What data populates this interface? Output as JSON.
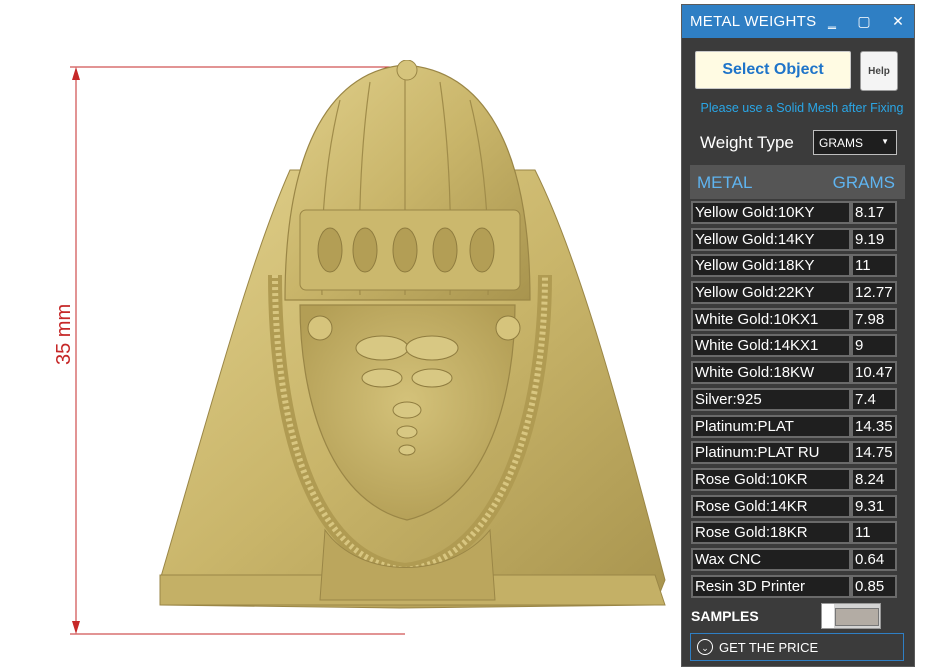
{
  "viewport": {
    "dimension_label": "35 mm",
    "colors": {
      "dimension": "#c62828",
      "model": "#c9b56a"
    }
  },
  "panel": {
    "title": "METAL WEIGHTS",
    "window_buttons": {
      "minimize": "‗",
      "maximize": "▢",
      "close": "✕"
    },
    "select_object_label": "Select Object",
    "help_label": "Help",
    "hint": "Please use a Solid Mesh after Fixing",
    "weight_type_label": "Weight Type",
    "weight_type_value": "GRAMS",
    "table_header": {
      "metal": "METAL",
      "unit": "GRAMS"
    },
    "rows": [
      {
        "name": "Yellow Gold:10KY",
        "value": "8.17"
      },
      {
        "name": "Yellow Gold:14KY",
        "value": "9.19"
      },
      {
        "name": "Yellow Gold:18KY",
        "value": "11"
      },
      {
        "name": "Yellow Gold:22KY",
        "value": "12.77"
      },
      {
        "name": "White Gold:10KX1",
        "value": "7.98"
      },
      {
        "name": "White Gold:14KX1",
        "value": "9"
      },
      {
        "name": "White Gold:18KW",
        "value": "10.47"
      },
      {
        "name": "Silver:925",
        "value": "7.4"
      },
      {
        "name": "Platinum:PLAT",
        "value": "14.35"
      },
      {
        "name": "Platinum:PLAT RU",
        "value": "14.75"
      },
      {
        "name": "Rose Gold:10KR",
        "value": "8.24"
      },
      {
        "name": "Rose Gold:14KR",
        "value": "9.31"
      },
      {
        "name": "Rose Gold:18KR",
        "value": "11"
      },
      {
        "name": "Wax  CNC",
        "value": "0.64"
      },
      {
        "name": "Resin 3D Printer",
        "value": "0.85"
      }
    ],
    "samples_label": "SAMPLES",
    "get_price_label": "GET THE PRICE",
    "colors": {
      "title_bar": "#2f7fc4",
      "accent_text": "#2aa6e6"
    }
  }
}
